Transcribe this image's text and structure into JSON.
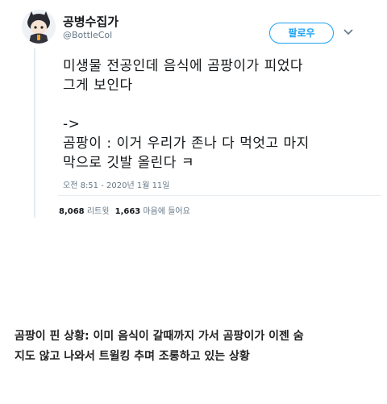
{
  "tweet": {
    "display_name": "공병수집가",
    "handle": "@BottleCol",
    "follow_label": "팔로우",
    "lines": [
      "미생물 전공인데 음식에 곰팡이가 피었다",
      "그게 보인다",
      "",
      "->",
      "곰팡이 : 이거 우리가 존나 다 먹엇고 마지",
      "막으로 깃발 올린다 ㅋ"
    ],
    "timestamp": "오전 8:51 - 2020년 1월 11일",
    "retweet_count": "8,068",
    "retweet_label": "리트윗",
    "like_count": "1,663",
    "like_label": "마음에 들어요"
  },
  "caption": {
    "line1": "곰팡이 핀 상황: 이미 음식이 갈때까지 가서 곰팡이가 이젠 숨",
    "line2": "지도 않고 나와서 트윌킹 추며 조롱하고 있는 상황"
  },
  "colors": {
    "accent": "#1da1f2",
    "secondary_text": "#657786",
    "divider": "#e6ecf0"
  }
}
